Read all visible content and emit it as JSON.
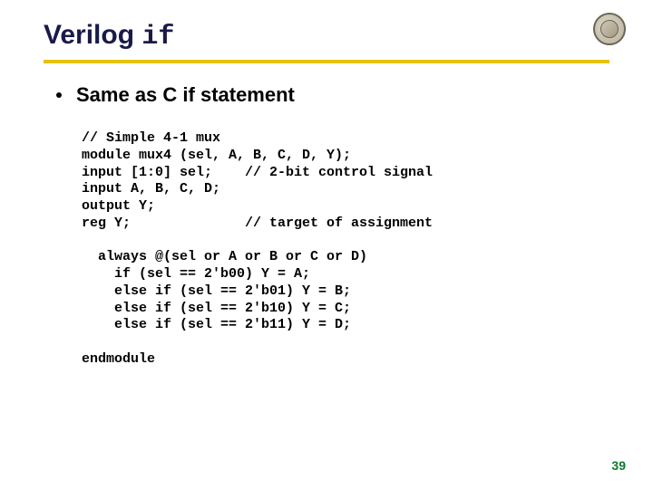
{
  "title_prefix": "Verilog ",
  "title_keyword": "if",
  "bullet": "Same as C if statement",
  "code": "// Simple 4-1 mux\nmodule mux4 (sel, A, B, C, D, Y);\ninput [1:0] sel;    // 2-bit control signal\ninput A, B, C, D;\noutput Y;\nreg Y;              // target of assignment\n\n  always @(sel or A or B or C or D)\n    if (sel == 2'b00) Y = A;\n    else if (sel == 2'b01) Y = B;\n    else if (sel == 2'b10) Y = C;\n    else if (sel == 2'b11) Y = D;\n\nendmodule",
  "page_number": "39"
}
